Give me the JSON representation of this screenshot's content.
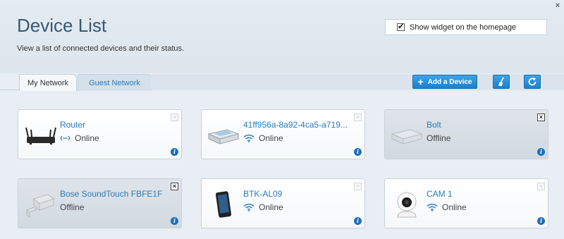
{
  "header": {
    "title": "Device List",
    "subtitle": "View a list of connected devices and their status.",
    "widget_label": "Show widget on the homepage",
    "widget_checked": true,
    "close_label": "×"
  },
  "tabs": [
    {
      "label": "My Network",
      "active": true
    },
    {
      "label": "Guest Network",
      "active": false
    }
  ],
  "toolbar": {
    "add_label": "Add a Device",
    "clean_icon": "broom-icon",
    "refresh_icon": "refresh-icon"
  },
  "devices": [
    {
      "name": "Router",
      "status": "Online",
      "connection": "ethernet",
      "icon": "router-icon",
      "offline": false
    },
    {
      "name": "41ff956a-8a92-4ca5-a719...",
      "status": "Online",
      "connection": "wifi",
      "icon": "device-box-icon",
      "offline": false
    },
    {
      "name": "Bolt",
      "status": "Offline",
      "connection": "none",
      "icon": "device-box-icon",
      "offline": true
    },
    {
      "name": "Bose SoundTouch FBFE1F",
      "status": "Offline",
      "connection": "none",
      "icon": "speaker-icon",
      "offline": true
    },
    {
      "name": "BTK-AL09",
      "status": "Online",
      "connection": "wifi",
      "icon": "phone-icon",
      "offline": false
    },
    {
      "name": "CAM 1",
      "status": "Online",
      "connection": "wifi",
      "icon": "camera-icon",
      "offline": false
    }
  ],
  "colors": {
    "accent": "#2b7bb9",
    "title": "#345a78",
    "button": "#1d80cc"
  }
}
